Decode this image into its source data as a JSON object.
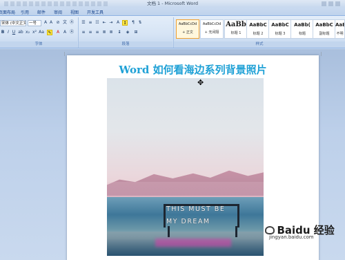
{
  "window": {
    "title": "文档 1 - Microsoft Word"
  },
  "tabs": [
    "页面布局",
    "引用",
    "邮件",
    "审阅",
    "视图",
    "开发工具"
  ],
  "font": {
    "name": "宋体 (中文正文)",
    "size": "一号"
  },
  "groups": {
    "font": "字体",
    "paragraph": "段落",
    "styles": "样式"
  },
  "styles": [
    {
      "sample": "AaBbCcDd",
      "name": "+ 正文",
      "size": "small",
      "selected": true
    },
    {
      "sample": "AaBbCcDd",
      "name": "+ 无间隔",
      "size": "small"
    },
    {
      "sample": "AaBb",
      "name": "标题 1",
      "size": "big"
    },
    {
      "sample": "AaBbC",
      "name": "标题 2",
      "size": "med"
    },
    {
      "sample": "AaBbC",
      "name": "标题 3",
      "size": "med"
    },
    {
      "sample": "AaBb(",
      "name": "标题",
      "size": "med"
    },
    {
      "sample": "AaBbC",
      "name": "副标题",
      "size": "med"
    },
    {
      "sample": "AaBbC",
      "name": "不明",
      "size": "med"
    }
  ],
  "document": {
    "title": "Word 如何看海边系列背景照片",
    "photo_lines": [
      "THIS MUST BE",
      "MY DREAM"
    ]
  },
  "watermark": {
    "text": "Baidu 经验",
    "url": "jingyan.baidu.com"
  },
  "icons": [
    "move-cursor-icon",
    "bold-icon",
    "italic-icon",
    "underline-icon",
    "align-left-icon",
    "align-center-icon",
    "align-right-icon",
    "justify-icon",
    "bullets-icon",
    "numbering-icon",
    "indent-icon",
    "highlight-icon",
    "font-color-icon",
    "minimize-icon",
    "maximize-icon",
    "close-icon"
  ],
  "colors": {
    "title": "#1fa1d6",
    "ribbon": "#dbe7f6"
  }
}
